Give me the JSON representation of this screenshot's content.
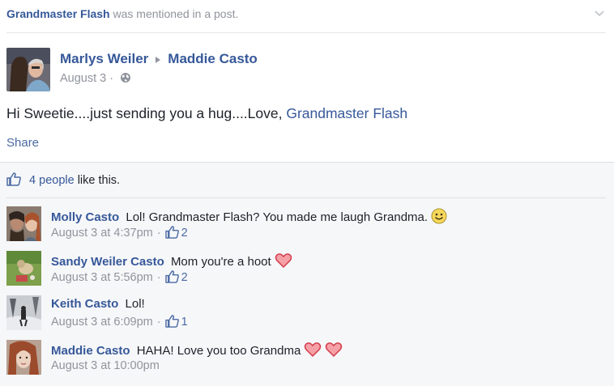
{
  "header": {
    "actor": "Grandmaster Flash",
    "text": "was mentioned in a post."
  },
  "post": {
    "author": "Marlys Weiler",
    "target": "Maddie Casto",
    "date": "August 3",
    "dot": "·",
    "body_text": "Hi Sweetie....just sending you a hug....Love, ",
    "body_mention": "Grandmaster Flash",
    "share_label": "Share"
  },
  "likes": {
    "count_text": "4 people",
    "suffix": "like this."
  },
  "comments": [
    {
      "author": "Molly Casto",
      "text": "Lol! Grandmaster Flash? You made me laugh Grandma.",
      "time": "August 3 at 4:37pm",
      "like_count": "2",
      "emoji": "smiley"
    },
    {
      "author": "Sandy Weiler Casto",
      "text": "Mom you're a hoot",
      "time": "August 3 at 5:56pm",
      "like_count": "2",
      "emoji": "heart"
    },
    {
      "author": "Keith Casto",
      "text": "Lol!",
      "time": "August 3 at 6:09pm",
      "like_count": "1",
      "emoji": ""
    },
    {
      "author": "Maddie Casto",
      "text": "HAHA! Love you too Grandma",
      "time": "August 3 at 10:00pm",
      "like_count": "",
      "emoji": "heart-heart"
    }
  ],
  "icons": {
    "chevron": "chevron-down-icon",
    "arrow": "triangle-right-icon",
    "globe": "globe-icon",
    "thumb": "thumbs-up-icon",
    "smiley": "smiley-icon",
    "heart": "heart-icon"
  },
  "colors": {
    "link": "#365899",
    "muted": "#90949c",
    "feedback_bg": "#f6f7f9",
    "heart": "#e9525e"
  }
}
